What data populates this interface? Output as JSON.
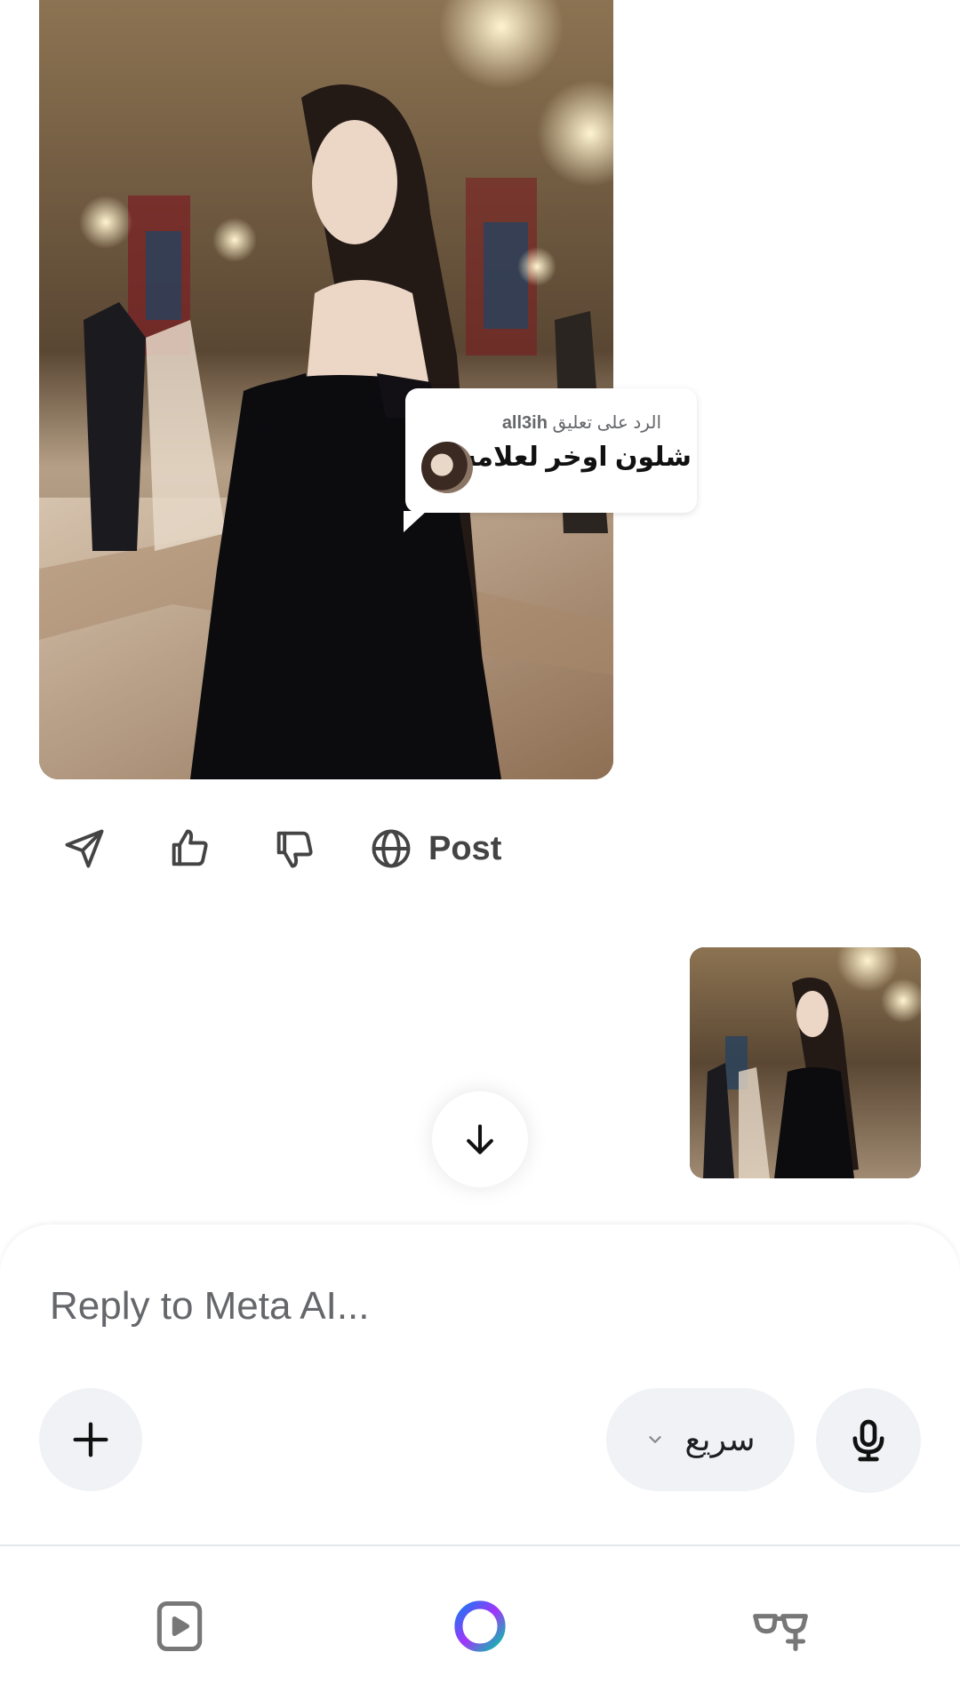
{
  "generated_image": {
    "alt": ""
  },
  "comment": {
    "reply_prefix": "الرد على تعليق",
    "username": "all3ih",
    "text": "شلون اوخر لعلامه"
  },
  "actions": {
    "share_icon": "send-icon",
    "like_icon": "thumbs-up-icon",
    "dislike_icon": "thumbs-down-icon",
    "post_icon": "globe-icon",
    "post_label": "Post"
  },
  "composer": {
    "placeholder": "Reply to Meta AI...",
    "value": "",
    "mode_label": "سريع"
  },
  "bottom_nav": {
    "items": [
      "reels-icon",
      "meta-ai-icon",
      "glasses-icon"
    ]
  },
  "colors": {
    "meta_ai_ring_start": "#1877f2",
    "meta_ai_ring_mid": "#a334fa",
    "meta_ai_ring_end": "#00c6a7",
    "secondary_text": "#65676b",
    "chip_bg": "#f0f2f5"
  }
}
